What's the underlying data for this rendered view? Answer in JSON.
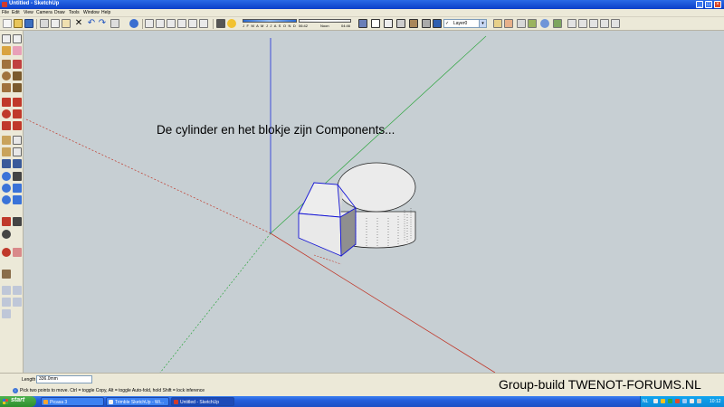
{
  "window": {
    "title": "Untitled - SketchUp",
    "buttons": {
      "minimize": "_",
      "maximize": "□",
      "close": "×"
    }
  },
  "menu": [
    "File",
    "Edit",
    "View",
    "Camera",
    "Draw",
    "Tools",
    "Window",
    "Help"
  ],
  "toolbar": {
    "months": "J F M A M J J A S O N D",
    "time_start": "06:42",
    "time_noon": "Noon",
    "time_end": "04:46",
    "layer": "Layer0",
    "layer_check": "✓"
  },
  "viewport": {
    "annotation": "De cylinder en het blokje zijn Components...",
    "colors": {
      "background": "#c7cfd3",
      "red_axis": "#c0392b",
      "green_axis": "#2fa640",
      "blue_axis": "#2f3fd8",
      "selection": "#1515d6"
    }
  },
  "status": {
    "measure_label": "Length",
    "measure_value": "336.0mm",
    "hint": "Pick two points to move.  Ctrl = toggle Copy, Alt = toggle Auto-fold, hold Shift = lock inference",
    "info_icon": "i",
    "watermark": "Group-build TWENOT-FORUMS.NL"
  },
  "taskbar": {
    "start": "start",
    "tasks": [
      "Picasa 3",
      "Trimble SketchUp - Wi...",
      "Untitled - SketchUp"
    ],
    "lang": "NL",
    "clock": "10:12"
  }
}
